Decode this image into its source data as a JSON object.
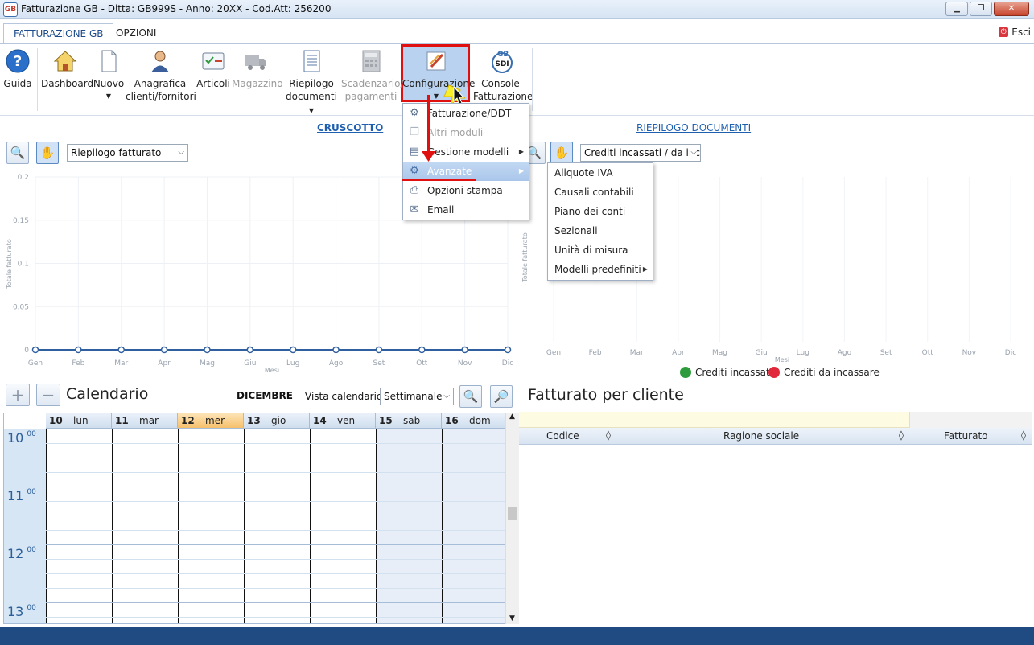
{
  "window": {
    "title": "Fatturazione GB - Ditta: GB999S - Anno: 20XX - Cod.Att: 256200",
    "logo_text": "GB"
  },
  "tabs": [
    "FATTURAZIONE GB",
    "OPZIONI"
  ],
  "exit_label": "Esci",
  "ribbon": {
    "guida": "Guida",
    "dashboard": "Dashboard",
    "nuovo": "Nuovo",
    "anagrafica_1": "Anagrafica",
    "anagrafica_2": "clienti/fornitori",
    "articoli": "Articoli",
    "magazzino": "Magazzino",
    "riepilogo_1": "Riepilogo",
    "riepilogo_2": "documenti",
    "scadenzario_1": "Scadenzario/",
    "scadenzario_2": "pagamenti",
    "configurazione": "Configurazione",
    "console_1": "Console",
    "console_2": "Fatturazione",
    "sdi_badge": "SDI"
  },
  "sections": {
    "cruscotto": "CRUSCOTTO",
    "riepilogo_documenti": "RIEPILOGO DOCUMENTI"
  },
  "left_chart_select": "Riepilogo fatturato",
  "right_chart_select": "Crediti incassati / da inc",
  "chart_data": [
    {
      "type": "line",
      "categories": [
        "Gen",
        "Feb",
        "Mar",
        "Apr",
        "Mag",
        "Giu",
        "Lug",
        "Ago",
        "Set",
        "Ott",
        "Nov",
        "Dic"
      ],
      "series": [
        {
          "values": [
            0,
            0,
            0,
            0,
            0,
            0,
            0,
            0,
            0,
            0,
            0,
            0
          ]
        }
      ],
      "yticks": [
        "0",
        "0.05",
        "0.1",
        "0.15",
        "0.2"
      ],
      "ylim": [
        0,
        0.2
      ],
      "xlabel": "Mesi",
      "ylabel": "Totale fatturato",
      "grid": true,
      "color": "#2f5f9e"
    },
    {
      "type": "bar",
      "categories": [
        "Gen",
        "Feb",
        "Mar",
        "Apr",
        "Mag",
        "Giu",
        "Lug",
        "Ago",
        "Set",
        "Ott",
        "Nov",
        "Dic"
      ],
      "series": [
        {
          "name": "Crediti incassati",
          "values": [],
          "color": "#2e9c3c"
        },
        {
          "name": "Crediti da incassare",
          "values": [],
          "color": "#e0283a"
        }
      ],
      "xlabel": "Mesi",
      "ylabel": "Totale fatturato",
      "legend": "bottom"
    }
  ],
  "calendar": {
    "title": "Calendario",
    "month": "DICEMBRE",
    "view_label": "Vista calendario",
    "view_value": "Settimanale",
    "days": [
      {
        "num": "10",
        "name": "lun"
      },
      {
        "num": "11",
        "name": "mar"
      },
      {
        "num": "12",
        "name": "mer"
      },
      {
        "num": "13",
        "name": "gio"
      },
      {
        "num": "14",
        "name": "ven"
      },
      {
        "num": "15",
        "name": "sab"
      },
      {
        "num": "16",
        "name": "dom"
      }
    ],
    "hours": [
      "10",
      "11",
      "12",
      "13"
    ],
    "minutes": "00"
  },
  "fatturato_per_cliente": {
    "title": "Fatturato per cliente",
    "columns": [
      "Codice",
      "Ragione sociale",
      "Fatturato"
    ]
  },
  "config_menu": {
    "items": [
      {
        "label": "Fatturazione/DDT",
        "icon": "gear-icon"
      },
      {
        "label": "Altri moduli",
        "icon": "documents-icon"
      },
      {
        "label": "Gestione modelli",
        "icon": "template-icon"
      },
      {
        "label": "Avanzate",
        "icon": "gear-advanced-icon"
      },
      {
        "label": "Opzioni stampa",
        "icon": "printer-icon"
      },
      {
        "label": "Email",
        "icon": "email-icon"
      }
    ]
  },
  "advanced_menu": {
    "items": [
      "Aliquote IVA",
      "Causali contabili",
      "Piano dei conti",
      "Sezionali",
      "Unità di misura",
      "Modelli predefiniti"
    ]
  }
}
